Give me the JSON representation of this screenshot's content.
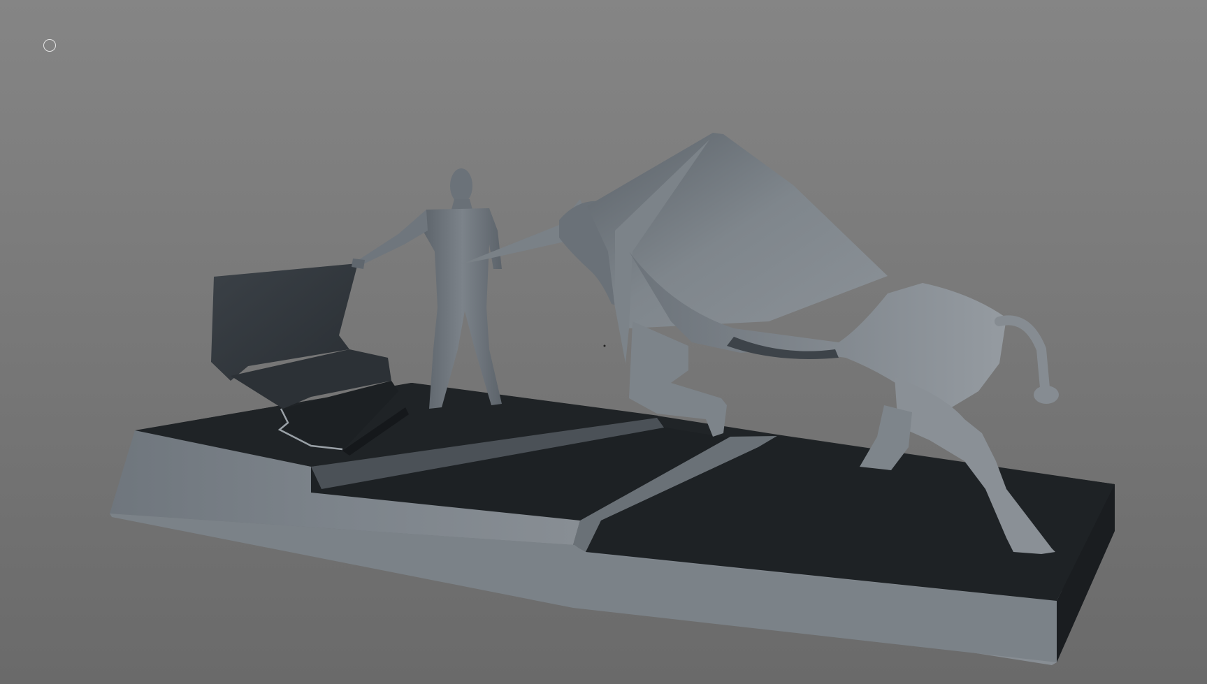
{
  "viewport": {
    "background_top": "#858585",
    "background_bottom": "#6a6a6a"
  },
  "overlay": {
    "marker_icon": "circle-outline-icon",
    "marker_color": "#e6e6e6"
  },
  "model": {
    "shading_color_light": "#8a9096",
    "shading_color_dark": "#1f2326",
    "objects": [
      "base",
      "bull",
      "matador",
      "cape"
    ]
  }
}
